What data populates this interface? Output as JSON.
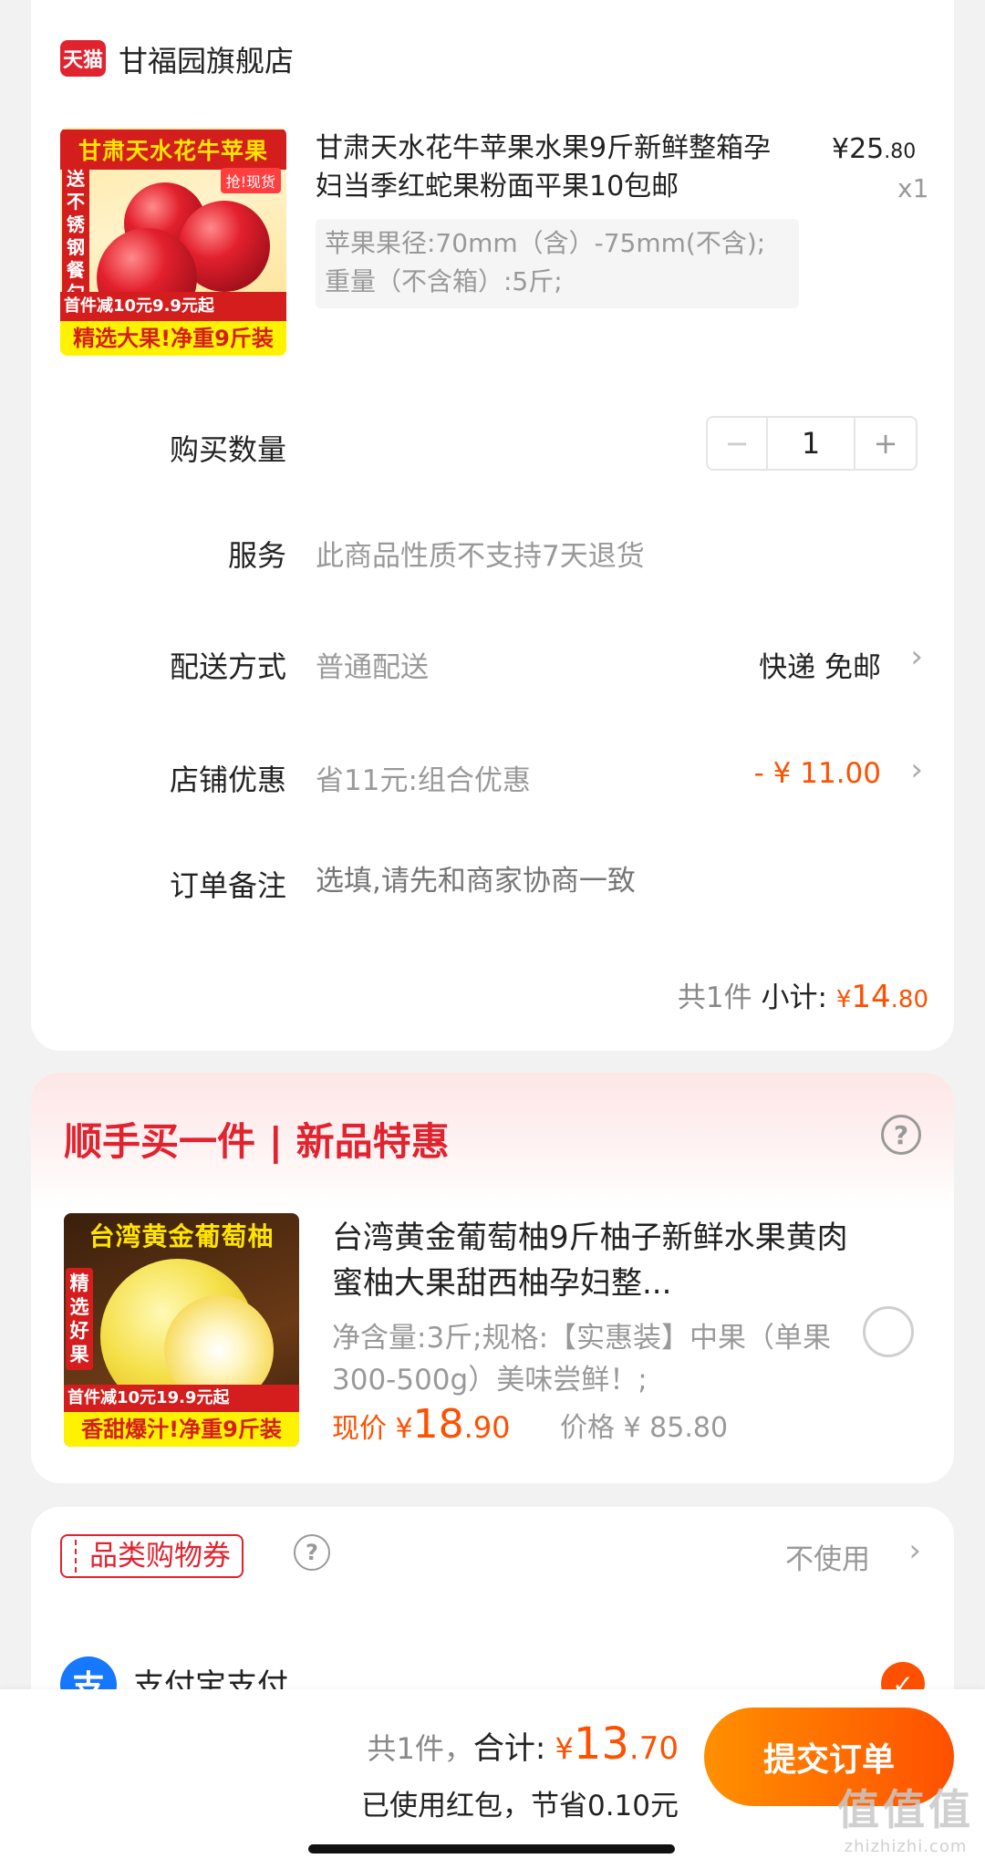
{
  "store": {
    "logo_text": "天猫",
    "name": "甘福园旗舰店"
  },
  "product": {
    "image": {
      "title": "甘肃天水花牛苹果",
      "side_text": "送不锈钢餐勺",
      "tag": "抢!现货",
      "promo": "首件减10元9.9元起",
      "banner": "精选大果!净重9斤装"
    },
    "title": "甘肃天水花牛苹果水果9斤新鲜整箱孕妇当季红蛇果粉面平果10包邮",
    "price_symbol": "¥",
    "price_int": "25",
    "price_dec": ".80",
    "quantity_label": "x1",
    "sku": "苹果果径:70mm（含）-75mm(不含);重量（不含箱）:5斤;"
  },
  "order": {
    "quantity_label": "购买数量",
    "stepper_minus": "−",
    "stepper_value": "1",
    "stepper_plus": "+",
    "service_label": "服务",
    "service_value": "此商品性质不支持7天退货",
    "delivery_label": "配送方式",
    "delivery_value": "普通配送",
    "delivery_right": "快递 免邮",
    "discount_label": "店铺优惠",
    "discount_value": "省11元:组合优惠",
    "discount_amount": "- ¥ 11.00",
    "note_label": "订单备注",
    "note_placeholder": "选填,请先和商家协商一致",
    "count_text": "共1件",
    "subtotal_label": "小计:",
    "subtotal_symbol": "¥",
    "subtotal_int": "14",
    "subtotal_dec": ".80"
  },
  "addon": {
    "title": "顺手买一件 | 新品特惠",
    "help": "?",
    "image": {
      "title": "台湾黄金葡萄柚",
      "side_text": "精选好果",
      "promo": "首件减10元19.9元起",
      "banner": "香甜爆汁!净重9斤装"
    },
    "name": "台湾黄金葡萄柚9斤柚子新鲜水果黄肉蜜柚大果甜西柚孕妇整...",
    "spec": "净含量:3斤;规格:【实惠装】中果（单果300-500g）美味尝鲜！;",
    "now_label": "现价",
    "price_symbol": "¥",
    "price_int": "18",
    "price_dec": ".90",
    "orig_price": "价格 ¥ 85.80"
  },
  "payment": {
    "coupon_label": "品类购物券",
    "coupon_help": "?",
    "coupon_value": "不使用",
    "alipay_icon": "支",
    "alipay_label": "支付宝支付",
    "check": "✓"
  },
  "footer": {
    "count_text": "共1件，",
    "total_label": "合计:",
    "total_symbol": "¥",
    "total_int": "13",
    "total_dec": ".70",
    "saving_text": "已使用红包，节省0.10元",
    "submit": "提交订单"
  },
  "watermark": {
    "big": "值值值",
    "small": "zhizhizhi.com"
  },
  "colors": {
    "accent": "#ff5000",
    "brand_red": "#e1232f",
    "alipay": "#1677ff"
  }
}
